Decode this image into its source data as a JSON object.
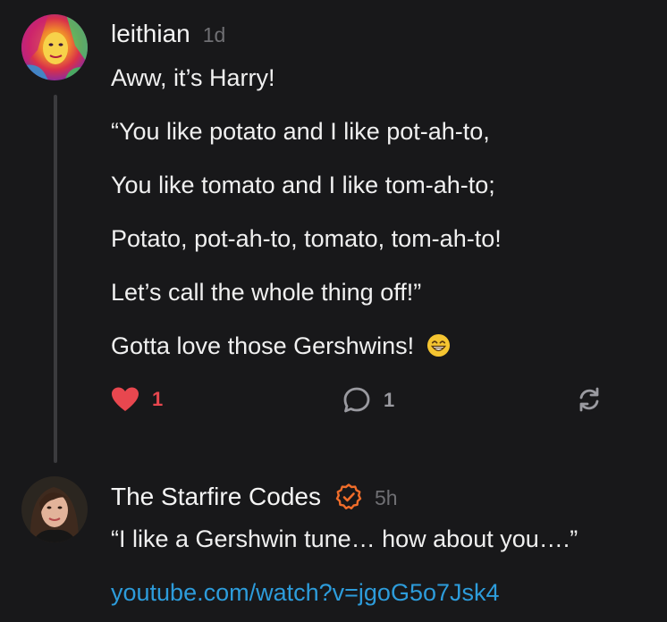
{
  "posts": [
    {
      "author": "leithian",
      "time": "1d",
      "lines": [
        "Aww, it’s Harry!",
        "“You like potato and I like pot-ah-to,",
        "You like tomato and I like tom-ah-to;",
        "Potato, pot-ah-to, tomato, tom-ah-to!",
        "Let’s call the whole thing off!”",
        "Gotta love those Gershwins!"
      ],
      "emoji": "grinning-face-with-smiling-eyes",
      "likes": "1",
      "replies": "1",
      "colors": {
        "like": "#e8474f",
        "icon": "#9a9aa0"
      }
    },
    {
      "author": "The Starfire Codes",
      "time": "5h",
      "verified_color": "#f06d2a",
      "lines": [
        "“I like a Gershwin tune… how about you….”"
      ],
      "link": "youtube.com/watch?v=jgoG5o7Jsk4",
      "link_color": "#2d9cdb"
    }
  ]
}
